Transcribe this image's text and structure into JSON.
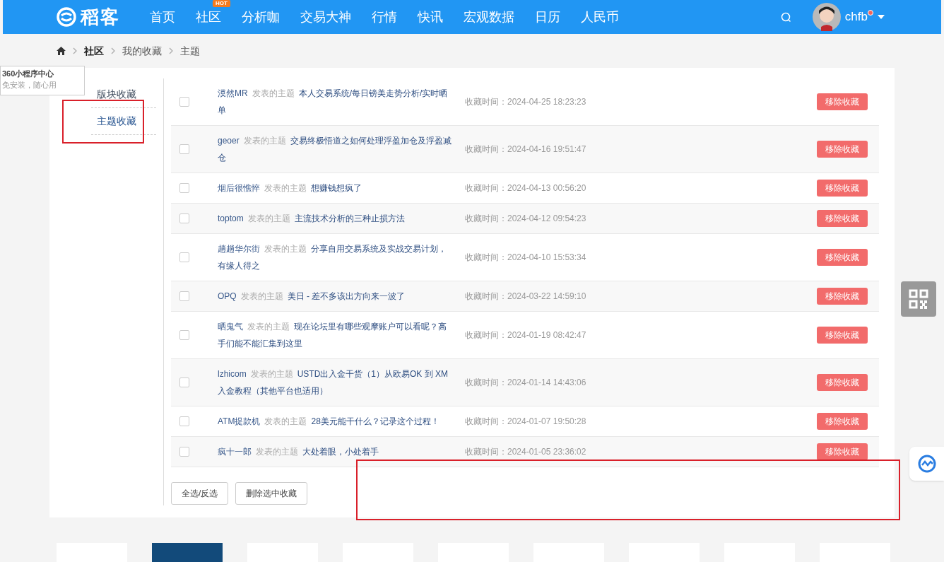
{
  "header": {
    "logo_text": "稻客",
    "nav": [
      {
        "label": "首页"
      },
      {
        "label": "社区",
        "badge": "HOT"
      },
      {
        "label": "分析咖"
      },
      {
        "label": "交易大神"
      },
      {
        "label": "行情"
      },
      {
        "label": "快讯"
      },
      {
        "label": "宏观数据"
      },
      {
        "label": "日历"
      },
      {
        "label": "人民币"
      }
    ],
    "username": "chfb",
    "has_notification": true
  },
  "breadcrumb": [
    "社区",
    "我的收藏",
    "主题"
  ],
  "popup": {
    "title": "360小程序中心",
    "subtitle": "免安装，随心用"
  },
  "sidebar": {
    "items": [
      {
        "label": "版块收藏",
        "selected": false
      },
      {
        "label": "主题收藏",
        "selected": true
      }
    ]
  },
  "favorites": [
    {
      "author": "漠然MR",
      "action": "发表的主题",
      "title": "本人交易系统/每日镑美走势分析/实时晒单",
      "time": "收藏时间：2024-04-25 18:23:23",
      "checked": false,
      "button": "移除收藏"
    },
    {
      "author": "geoer",
      "action": "发表的主题",
      "title": "交易终极悟道之如何处理浮盈加仓及浮盈减仓",
      "time": "收藏时间：2024-04-16 19:51:47",
      "checked": false,
      "button": "移除收藏"
    },
    {
      "author": "烟后很憔悴",
      "action": "发表的主题",
      "title": "想赚钱想疯了",
      "time": "收藏时间：2024-04-13 00:56:20",
      "checked": false,
      "button": "移除收藏"
    },
    {
      "author": "toptom",
      "action": "发表的主题",
      "title": "主流技术分析的三种止损方法",
      "time": "收藏时间：2024-04-12 09:54:23",
      "checked": false,
      "button": "移除收藏"
    },
    {
      "author": "趟趟华尔街",
      "action": "发表的主题",
      "title": "分享自用交易系统及实战交易计划，有缘人得之",
      "time": "收藏时间：2024-04-10 15:53:34",
      "checked": false,
      "button": "移除收藏"
    },
    {
      "author": "OPQ",
      "action": "发表的主题",
      "title": "美日 - 差不多该出方向来一波了",
      "time": "收藏时间：2024-03-22 14:59:10",
      "checked": false,
      "button": "移除收藏"
    },
    {
      "author": "晒鬼气",
      "action": "发表的主题",
      "title": "现在论坛里有哪些观摩账户可以看呢？高手们能不能汇集到这里",
      "time": "收藏时间：2024-01-19 08:42:47",
      "checked": false,
      "button": "移除收藏"
    },
    {
      "author": "lzhicom",
      "action": "发表的主题",
      "title": "USTD出入金干货（1）从欧易OK 到 XM 入金教程（其他平台也适用）",
      "time": "收藏时间：2024-01-14 14:43:06",
      "checked": false,
      "button": "移除收藏"
    },
    {
      "author": "ATM提款机",
      "action": "发表的主题",
      "title": "28美元能干什么？记录这个过程！",
      "time": "收藏时间：2024-01-07 19:50:28",
      "checked": false,
      "button": "移除收藏"
    },
    {
      "author": "疯十一郎",
      "action": "发表的主题",
      "title": "大处着眼，小处着手",
      "time": "收藏时间：2024-01-05 23:36:02",
      "checked": false,
      "button": "移除收藏"
    }
  ],
  "actions": [
    "全选/反选",
    "删除选中收藏"
  ]
}
